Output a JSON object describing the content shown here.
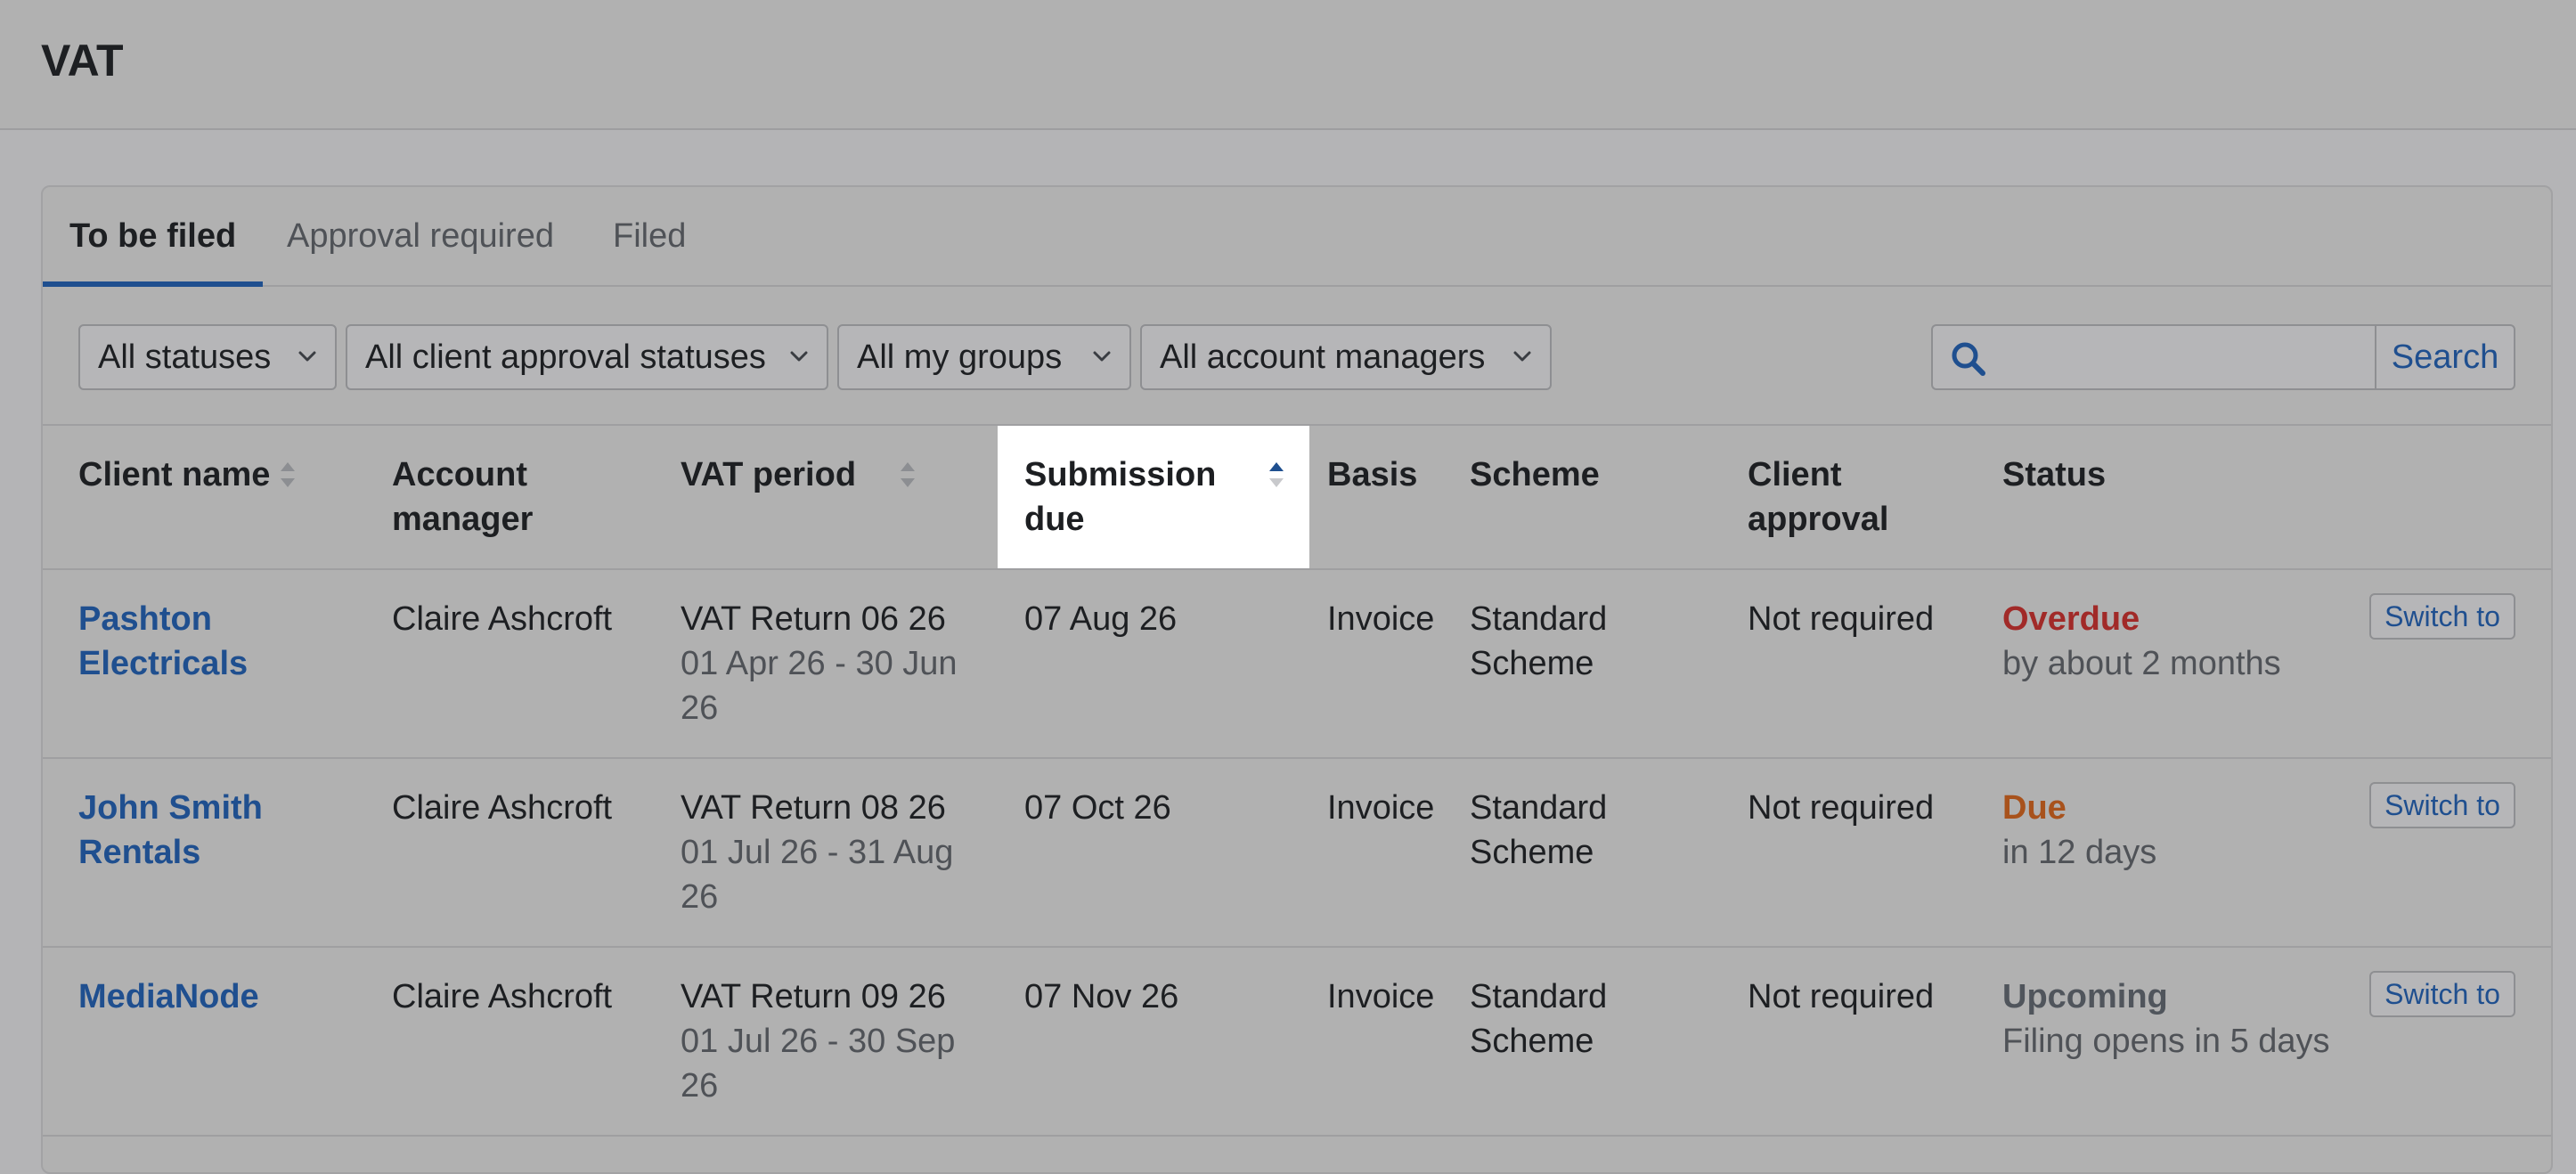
{
  "page": {
    "title": "VAT"
  },
  "tabs": [
    {
      "label": "To be filed",
      "active": true
    },
    {
      "label": "Approval required",
      "active": false
    },
    {
      "label": "Filed",
      "active": false
    }
  ],
  "filters": {
    "status": "All statuses",
    "client_approval": "All client approval statuses",
    "groups": "All my groups",
    "account_managers": "All account managers",
    "search_value": "",
    "search_button": "Search"
  },
  "columns": {
    "client_name": "Client name",
    "account_manager_l1": "Account",
    "account_manager_l2": "manager",
    "vat_period": "VAT period",
    "submission_due_l1": "Submission",
    "submission_due_l2": "due",
    "basis": "Basis",
    "scheme": "Scheme",
    "client_approval_l1": "Client",
    "client_approval_l2": "approval",
    "status": "Status"
  },
  "rows": [
    {
      "client_l1": "Pashton",
      "client_l2": "Electricals",
      "manager": "Claire Ashcroft",
      "return_name": "VAT Return 06 26",
      "period_l1": "01 Apr 26 - 30 Jun",
      "period_l2": "26",
      "due": "07 Aug 26",
      "basis": "Invoice",
      "scheme_l1": "Standard",
      "scheme_l2": "Scheme",
      "approval": "Not required",
      "status": "Overdue",
      "status_detail": "by about 2 months",
      "action": "Switch to"
    },
    {
      "client_l1": "John Smith",
      "client_l2": "Rentals",
      "manager": "Claire Ashcroft",
      "return_name": "VAT Return 08 26",
      "period_l1": "01 Jul 26 - 31 Aug",
      "period_l2": "26",
      "due": "07 Oct 26",
      "basis": "Invoice",
      "scheme_l1": "Standard",
      "scheme_l2": "Scheme",
      "approval": "Not required",
      "status": "Due",
      "status_detail": "in 12 days",
      "action": "Switch to"
    },
    {
      "client_l1": "MediaNode",
      "client_l2": "",
      "manager": "Claire Ashcroft",
      "return_name": "VAT Return 09 26",
      "period_l1": "01 Jul 26 - 30 Sep",
      "period_l2": "26",
      "due": "07 Nov 26",
      "basis": "Invoice",
      "scheme_l1": "Standard",
      "scheme_l2": "Scheme",
      "approval": "Not required",
      "status": "Upcoming",
      "status_detail": "Filing opens in 5 days",
      "action": "Switch to"
    }
  ],
  "colors": {
    "link": "#1f4f8f",
    "overdue": "#a12a28",
    "due": "#a8521c",
    "upcoming": "#50555c"
  },
  "icons": {
    "sort": "sort-icon",
    "sort_asc": "sort-ascending-icon",
    "chevron": "chevron-down-icon",
    "search": "search-icon"
  }
}
